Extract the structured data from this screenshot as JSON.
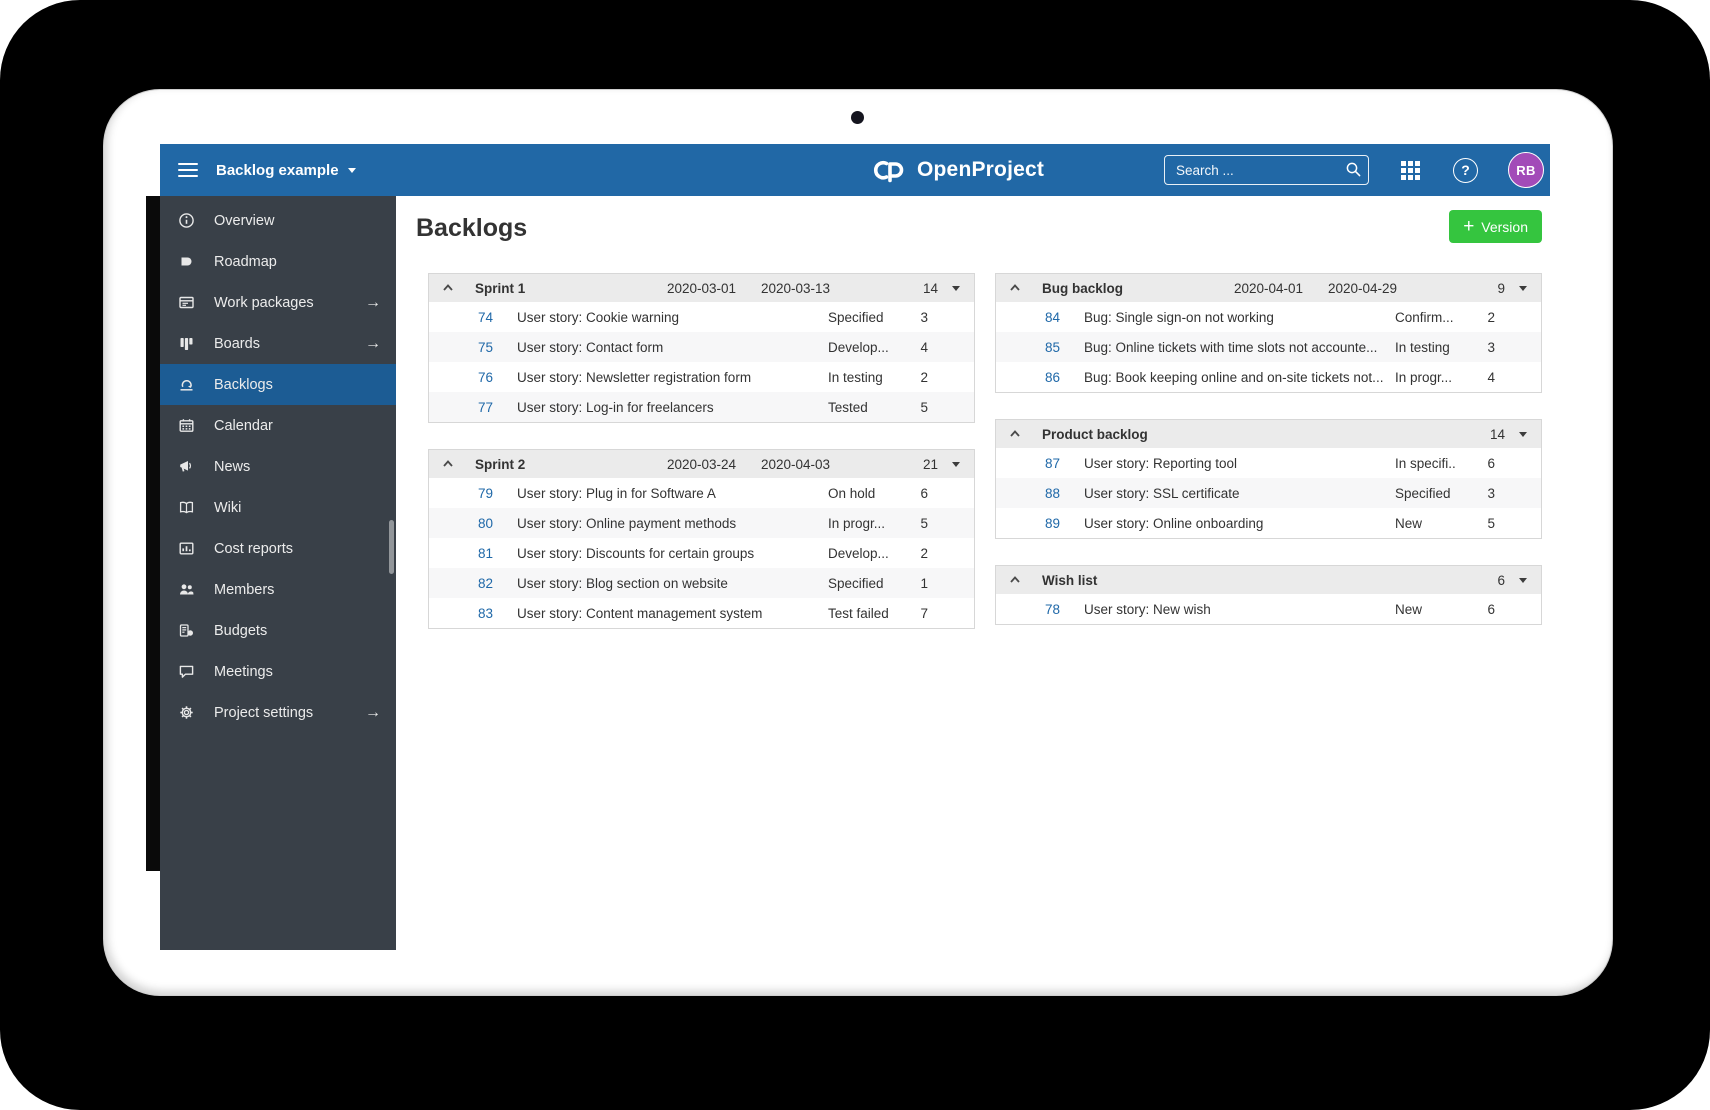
{
  "topbar": {
    "project_name": "Backlog example",
    "logo_text": "OpenProject",
    "search_placeholder": "Search ...",
    "avatar_initials": "RB"
  },
  "sidebar": {
    "items": [
      {
        "label": "Overview",
        "icon": "info-icon",
        "arrow": false,
        "active": false
      },
      {
        "label": "Roadmap",
        "icon": "roadmap-icon",
        "arrow": false,
        "active": false
      },
      {
        "label": "Work packages",
        "icon": "work-packages-icon",
        "arrow": true,
        "active": false
      },
      {
        "label": "Boards",
        "icon": "boards-icon",
        "arrow": true,
        "active": false
      },
      {
        "label": "Backlogs",
        "icon": "backlogs-icon",
        "arrow": false,
        "active": true
      },
      {
        "label": "Calendar",
        "icon": "calendar-icon",
        "arrow": false,
        "active": false
      },
      {
        "label": "News",
        "icon": "news-icon",
        "arrow": false,
        "active": false
      },
      {
        "label": "Wiki",
        "icon": "wiki-icon",
        "arrow": false,
        "active": false
      },
      {
        "label": "Cost reports",
        "icon": "cost-reports-icon",
        "arrow": false,
        "active": false
      },
      {
        "label": "Members",
        "icon": "members-icon",
        "arrow": false,
        "active": false
      },
      {
        "label": "Budgets",
        "icon": "budgets-icon",
        "arrow": false,
        "active": false
      },
      {
        "label": "Meetings",
        "icon": "meetings-icon",
        "arrow": false,
        "active": false
      },
      {
        "label": "Project settings",
        "icon": "settings-icon",
        "arrow": true,
        "active": false
      }
    ]
  },
  "main": {
    "title": "Backlogs",
    "version_button_label": "Version",
    "columns": {
      "left": [
        {
          "name": "Sprint 1",
          "start": "2020-03-01",
          "end": "2020-03-13",
          "count": "14",
          "items": [
            {
              "id": "74",
              "subject": "User story: Cookie warning",
              "status": "Specified",
              "points": "3"
            },
            {
              "id": "75",
              "subject": "User story: Contact form",
              "status": "Develop...",
              "points": "4"
            },
            {
              "id": "76",
              "subject": "User story: Newsletter registration form",
              "status": "In testing",
              "points": "2"
            },
            {
              "id": "77",
              "subject": "User story: Log-in for freelancers",
              "status": "Tested",
              "points": "5"
            }
          ]
        },
        {
          "name": "Sprint 2",
          "start": "2020-03-24",
          "end": "2020-04-03",
          "count": "21",
          "items": [
            {
              "id": "79",
              "subject": "User story: Plug in for Software A",
              "status": "On hold",
              "points": "6"
            },
            {
              "id": "80",
              "subject": "User story: Online payment methods",
              "status": "In progr...",
              "points": "5"
            },
            {
              "id": "81",
              "subject": "User story: Discounts for certain groups",
              "status": "Develop...",
              "points": "2"
            },
            {
              "id": "82",
              "subject": "User story: Blog section on website",
              "status": "Specified",
              "points": "1"
            },
            {
              "id": "83",
              "subject": "User story: Content management system",
              "status": "Test failed",
              "points": "7"
            }
          ]
        }
      ],
      "right": [
        {
          "name": "Bug backlog",
          "start": "2020-04-01",
          "end": "2020-04-29",
          "count": "9",
          "items": [
            {
              "id": "84",
              "subject": "Bug: Single sign-on not working",
              "status": "Confirm...",
              "points": "2"
            },
            {
              "id": "85",
              "subject": "Bug: Online tickets with time slots not accounte...",
              "status": "In testing",
              "points": "3"
            },
            {
              "id": "86",
              "subject": "Bug: Book keeping online and on-site tickets not...",
              "status": "In progr...",
              "points": "4"
            }
          ]
        },
        {
          "name": "Product backlog",
          "start": "",
          "end": "",
          "count": "14",
          "items": [
            {
              "id": "87",
              "subject": "User story: Reporting tool",
              "status": "In specifi..",
              "points": "6"
            },
            {
              "id": "88",
              "subject": "User story: SSL certificate",
              "status": "Specified",
              "points": "3"
            },
            {
              "id": "89",
              "subject": "User story: Online onboarding",
              "status": "New",
              "points": "5"
            }
          ]
        },
        {
          "name": "Wish list",
          "start": "",
          "end": "",
          "count": "6",
          "items": [
            {
              "id": "78",
              "subject": "User story: New wish",
              "status": "New",
              "points": "6"
            }
          ]
        }
      ]
    }
  },
  "colors": {
    "topbar_blue": "#2168A6",
    "sidebar_dark": "#394048",
    "sidebar_active_blue": "#1C5C94",
    "button_green": "#35C53F",
    "avatar_purple": "#A24BB8",
    "link_blue": "#1F68A8"
  }
}
